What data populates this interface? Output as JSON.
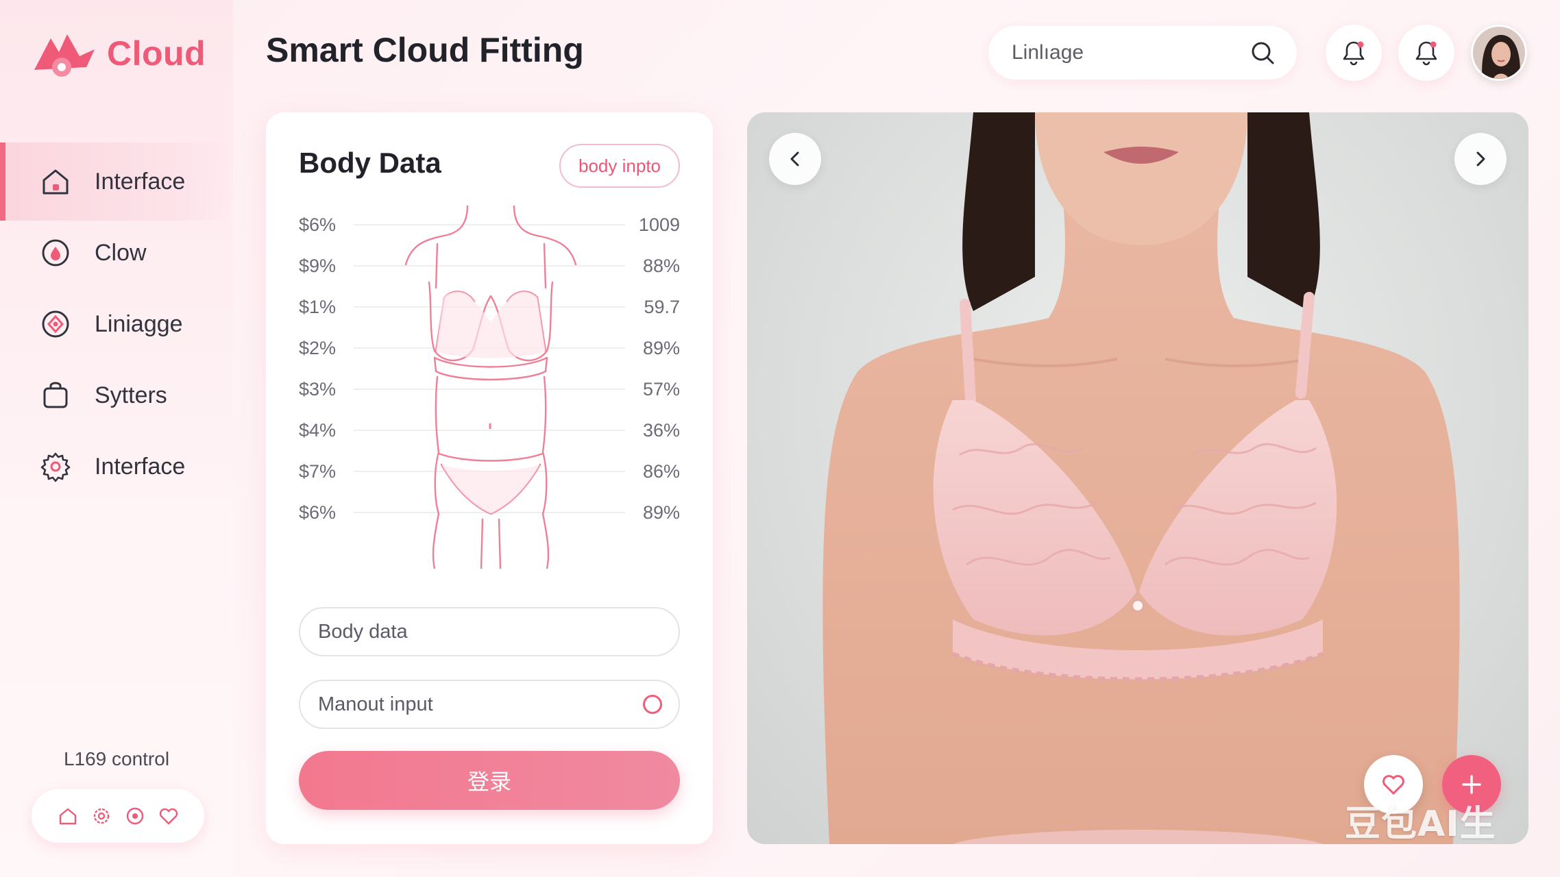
{
  "brand": {
    "name": "Cloud",
    "accent": "#ee5a78"
  },
  "header": {
    "title": "Smart Cloud Fitting",
    "search_value": "Linlıage",
    "search_icon": "search-icon",
    "bell_icon": "bell-icon"
  },
  "sidebar": {
    "items": [
      {
        "label": "Interface",
        "icon": "home-icon",
        "active": true
      },
      {
        "label": "Clow",
        "icon": "droplet-icon"
      },
      {
        "label": "Liniagge",
        "icon": "diamond-badge-icon"
      },
      {
        "label": "Sytters",
        "icon": "bag-icon"
      },
      {
        "label": "Interface",
        "icon": "gear-icon"
      }
    ],
    "footer_label": "L169 control",
    "footer_icons": [
      "home-icon",
      "gear-icon",
      "location-icon",
      "heart-icon"
    ]
  },
  "body_card": {
    "title": "Body Data",
    "chip": "body inpto",
    "left_values": [
      "$6%",
      "$9%",
      "$1%",
      "$2%",
      "$3%",
      "$4%",
      "$7%",
      "$6%"
    ],
    "right_values": [
      "1009",
      "88%",
      "59.7",
      "89%",
      "57%",
      "36%",
      "86%",
      "89%"
    ],
    "input1_placeholder": "Body data",
    "input2_placeholder": "Manout input",
    "submit_label": "登录"
  },
  "photo": {
    "prev_icon": "chevron-left-icon",
    "next_icon": "chevron-right-icon",
    "fav_icon": "heart-icon",
    "add_icon": "plus-icon",
    "watermark": "豆包AI生成"
  }
}
